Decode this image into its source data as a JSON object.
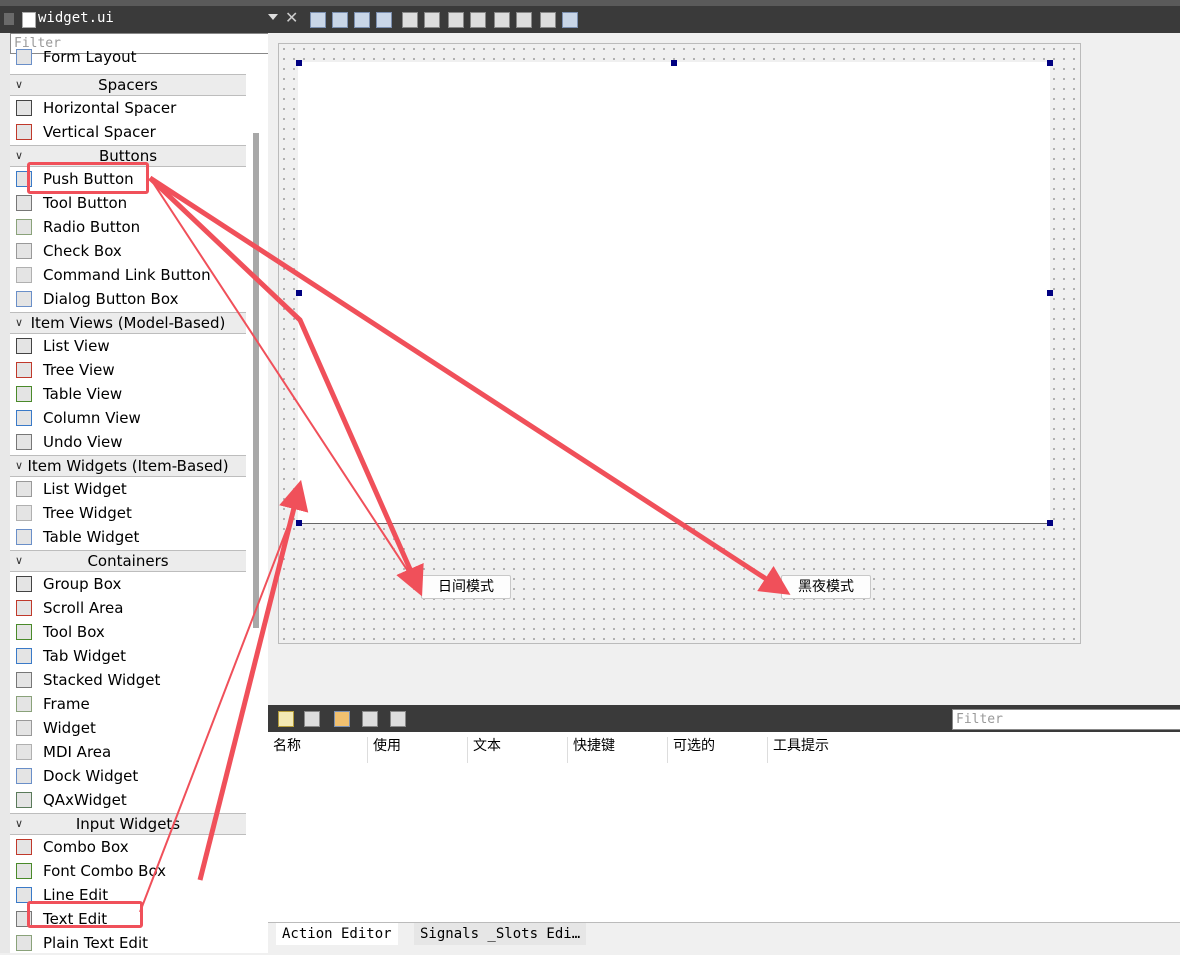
{
  "document": {
    "title": "widget.ui"
  },
  "widget_box": {
    "filter_placeholder": "Filter",
    "items": [
      {
        "kind": "item",
        "label": "Form Layout",
        "icon": "form-layout-icon"
      },
      {
        "kind": "cat",
        "label": "Spacers"
      },
      {
        "kind": "item",
        "label": "Horizontal Spacer",
        "icon": "horizontal-spacer-icon"
      },
      {
        "kind": "item",
        "label": "Vertical Spacer",
        "icon": "vertical-spacer-icon"
      },
      {
        "kind": "cat",
        "label": "Buttons"
      },
      {
        "kind": "item",
        "label": "Push Button",
        "icon": "push-button-icon"
      },
      {
        "kind": "item",
        "label": "Tool Button",
        "icon": "tool-button-icon"
      },
      {
        "kind": "item",
        "label": "Radio Button",
        "icon": "radio-button-icon"
      },
      {
        "kind": "item",
        "label": "Check Box",
        "icon": "check-box-icon"
      },
      {
        "kind": "item",
        "label": "Command Link Button",
        "icon": "command-link-icon"
      },
      {
        "kind": "item",
        "label": "Dialog Button Box",
        "icon": "dialog-button-box-icon"
      },
      {
        "kind": "cat",
        "label": "Item Views (Model-Based)"
      },
      {
        "kind": "item",
        "label": "List View",
        "icon": "list-view-icon"
      },
      {
        "kind": "item",
        "label": "Tree View",
        "icon": "tree-view-icon"
      },
      {
        "kind": "item",
        "label": "Table View",
        "icon": "table-view-icon"
      },
      {
        "kind": "item",
        "label": "Column View",
        "icon": "column-view-icon"
      },
      {
        "kind": "item",
        "label": "Undo View",
        "icon": "undo-view-icon"
      },
      {
        "kind": "cat",
        "label": "Item Widgets (Item-Based)"
      },
      {
        "kind": "item",
        "label": "List Widget",
        "icon": "list-widget-icon"
      },
      {
        "kind": "item",
        "label": "Tree Widget",
        "icon": "tree-widget-icon"
      },
      {
        "kind": "item",
        "label": "Table Widget",
        "icon": "table-widget-icon"
      },
      {
        "kind": "cat",
        "label": "Containers"
      },
      {
        "kind": "item",
        "label": "Group Box",
        "icon": "group-box-icon"
      },
      {
        "kind": "item",
        "label": "Scroll Area",
        "icon": "scroll-area-icon"
      },
      {
        "kind": "item",
        "label": "Tool Box",
        "icon": "tool-box-icon"
      },
      {
        "kind": "item",
        "label": "Tab Widget",
        "icon": "tab-widget-icon"
      },
      {
        "kind": "item",
        "label": "Stacked Widget",
        "icon": "stacked-widget-icon"
      },
      {
        "kind": "item",
        "label": "Frame",
        "icon": "frame-icon"
      },
      {
        "kind": "item",
        "label": "Widget",
        "icon": "widget-icon"
      },
      {
        "kind": "item",
        "label": "MDI Area",
        "icon": "mdi-area-icon"
      },
      {
        "kind": "item",
        "label": "Dock Widget",
        "icon": "dock-widget-icon"
      },
      {
        "kind": "item",
        "label": "QAxWidget",
        "icon": "qaxwidget-icon"
      },
      {
        "kind": "cat",
        "label": "Input Widgets"
      },
      {
        "kind": "item",
        "label": "Combo Box",
        "icon": "combo-box-icon"
      },
      {
        "kind": "item",
        "label": "Font Combo Box",
        "icon": "font-combo-box-icon"
      },
      {
        "kind": "item",
        "label": "Line Edit",
        "icon": "line-edit-icon"
      },
      {
        "kind": "item",
        "label": "Text Edit",
        "icon": "text-edit-icon"
      },
      {
        "kind": "item",
        "label": "Plain Text Edit",
        "icon": "plain-text-edit-icon"
      }
    ]
  },
  "form": {
    "day_mode_button": "日间模式",
    "night_mode_button": "黑夜模式"
  },
  "action_editor": {
    "filter_placeholder": "Filter",
    "columns": [
      "名称",
      "使用",
      "文本",
      "快捷键",
      "可选的",
      "工具提示"
    ]
  },
  "bottom_tabs": [
    "Action Editor",
    "Signals _Slots Edi…"
  ],
  "colors": {
    "highlight": "#f0505a",
    "handle": "#000080"
  }
}
